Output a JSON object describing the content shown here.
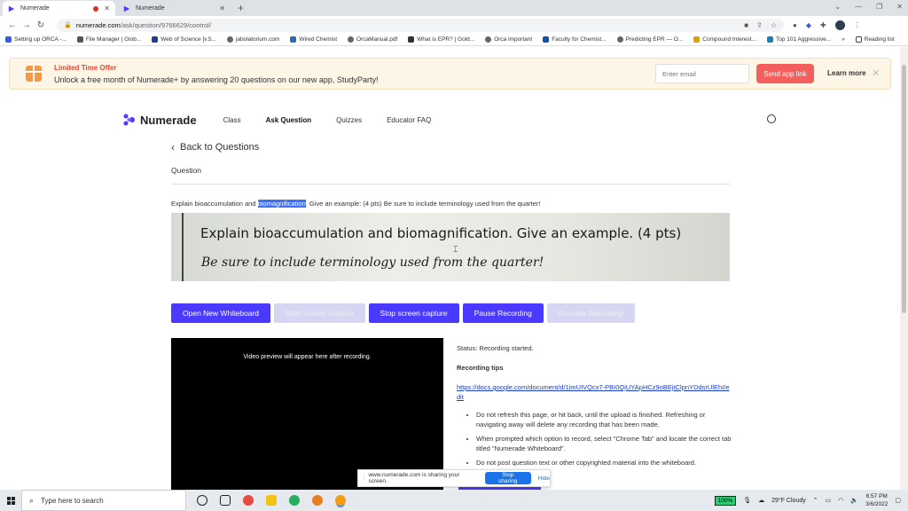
{
  "browser": {
    "tabs": [
      {
        "title": "Numerade",
        "recording": true
      },
      {
        "title": "Numerade",
        "recording": false
      }
    ],
    "url_host": "numerade.com",
    "url_path": "/ask/question/9766629/control/",
    "bookmarks": [
      "Setting up ORCA -...",
      "File Manager | Glob...",
      "Web of Science [v.5...",
      "jabolatorium.com",
      "Wired Chemist",
      "OrcaManual.pdf",
      "What is EPR? | Gold...",
      "Orca important",
      "Faculty for Chemist...",
      "Predicting EPR — O...",
      "Compound Interest...",
      "Top 101 Aggressive..."
    ],
    "reading_list": "Reading list"
  },
  "promo": {
    "offer": "Limited Time Offer",
    "message": "Unlock a free month of Numerade+ by answering 20 questions on our new app, StudyParty!",
    "email_placeholder": "Enter email",
    "send_label": "Send app link",
    "learn_label": "Learn more",
    "accent": "#f25f5c"
  },
  "nav": {
    "logo": "Numerade",
    "links": [
      "Class",
      "Ask Question",
      "Quizzes",
      "Educator FAQ"
    ]
  },
  "question": {
    "back_label": "Back to Questions",
    "section_label": "Question",
    "text_before": "Explain bioaccumulation and ",
    "text_highlight": "biomagnification",
    "text_after": ". Give an example: (4 pts) Be sure to include terminology used from the quarter!",
    "image_line1": "Explain bioaccumulation and biomagnification. Give an example. (4 pts)",
    "image_line2": "Be sure to include terminology used from the quarter!"
  },
  "controls": {
    "open_whiteboard": "Open New Whiteboard",
    "start_capture": "Start screen capture",
    "stop_capture": "Stop screen capture",
    "pause_recording": "Pause Recording",
    "resume_recording": "Resume Recording",
    "primary_color": "#4a3aff"
  },
  "video": {
    "caption": "Video preview will appear here after recording."
  },
  "info": {
    "status": "Status: Recording started.",
    "tips_title": "Recording tips",
    "link": "https://docs.google.com/document/d/1imUIVQcx7-PBI0QjUYApHCz9oBEjtClpnYDdsrUlEhI/edit",
    "tips": [
      "Do not refresh this page, or hit back, until the upload is finished. Refreshing or navigating away will delete any recording that has been made.",
      "When prompted which option to record, select \"Chrome Tab\" and locate the correct tab titled \"Numerade Whiteboard\".",
      "Do not post question text or other copyrighted material into the whiteboard."
    ]
  },
  "share_bar": {
    "message": "www.numerade.com is sharing your screen.",
    "stop_label": "Stop sharing",
    "hide_label": "Hide"
  },
  "taskbar": {
    "search_placeholder": "Type here to search",
    "battery": "100%",
    "weather": "29°F  Cloudy",
    "time": "6:57 PM",
    "date": "3/6/2022"
  }
}
